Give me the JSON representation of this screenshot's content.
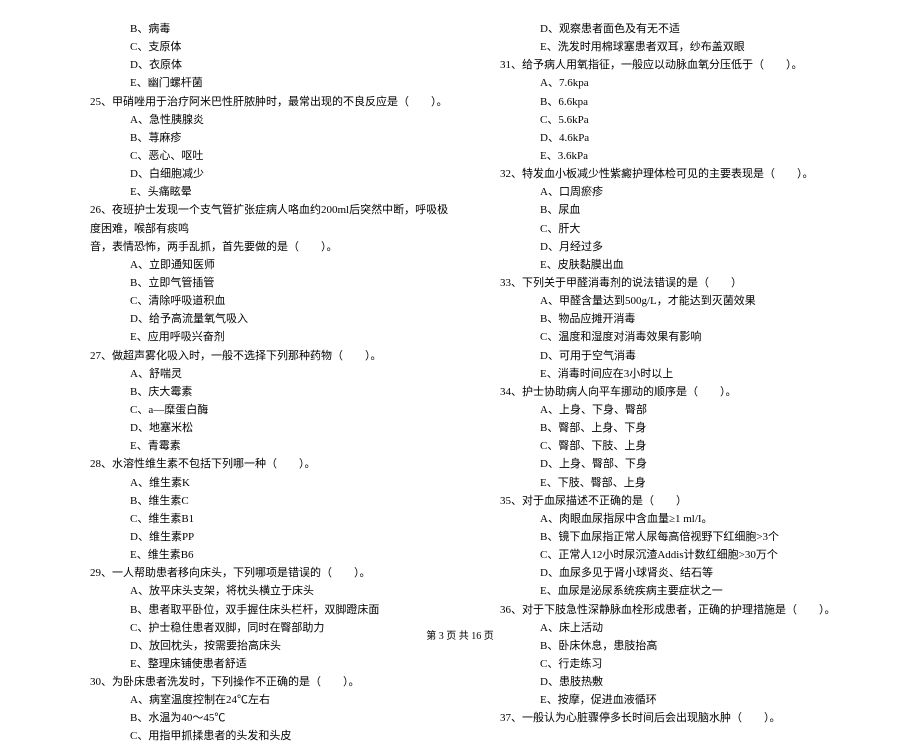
{
  "left": {
    "opts24": [
      "B、病毒",
      "C、支原体",
      "D、衣原体",
      "E、幽门螺杆菌"
    ],
    "q25": "25、甲硝唑用于治疗阿米巴性肝脓肿时，最常出现的不良反应是（　　）。",
    "opts25": [
      "A、急性胰腺炎",
      "B、荨麻疹",
      "C、恶心、呕吐",
      "D、白细胞减少",
      "E、头痛眩晕"
    ],
    "q26": "26、夜班护士发现一个支气管扩张症病人咯血约200ml后突然中断，呼吸极度困难，喉部有痰鸣",
    "q26b": "音，表情恐怖，两手乱抓，首先要做的是（　　）。",
    "opts26": [
      "A、立即通知医师",
      "B、立即气管插管",
      "C、清除呼吸道积血",
      "D、给予高流量氧气吸入",
      "E、应用呼吸兴奋剂"
    ],
    "q27": "27、做超声雾化吸入时，一般不选择下列那种药物（　　）。",
    "opts27": [
      "A、舒喘灵",
      "B、庆大霉素",
      "C、a—糜蛋白酶",
      "D、地塞米松",
      "E、青霉素"
    ],
    "q28": "28、水溶性维生素不包括下列哪一种（　　）。",
    "opts28": [
      "A、维生素K",
      "B、维生素C",
      "C、维生素B1",
      "D、维生素PP",
      "E、维生素B6"
    ],
    "q29": "29、一人帮助患者移向床头，下列哪项是错误的（　　）。",
    "opts29": [
      "A、放平床头支架，将枕头横立于床头",
      "B、患者取平卧位，双手握住床头栏杆，双脚蹬床面",
      "C、护士稳住患者双脚，同时在臀部助力",
      "D、放回枕头，按需要抬高床头",
      "E、整理床铺使患者舒适"
    ],
    "q30": "30、为卧床患者洗发时，下列操作不正确的是（　　）。",
    "opts30": [
      "A、病室温度控制在24℃左右",
      "B、水温为40～45℃",
      "C、用指甲抓揉患者的头发和头皮"
    ]
  },
  "right": {
    "opts30b": [
      "D、观察患者面色及有无不适",
      "E、洗发时用棉球塞患者双耳，纱布盖双眼"
    ],
    "q31": "31、给予病人用氧指征，一般应以动脉血氧分压低于（　　）。",
    "opts31": [
      "A、7.6kpa",
      "B、6.6kpa",
      "C、5.6kPa",
      "D、4.6kPa",
      "E、3.6kPa"
    ],
    "q32": "32、特发血小板减少性紫癜护理体检可见的主要表现是（　　）。",
    "opts32": [
      "A、口周瘀疹",
      "B、尿血",
      "C、肝大",
      "D、月经过多",
      "E、皮肤黏膜出血"
    ],
    "q33": "33、下列关于甲醛消毒剂的说法错误的是（　　）",
    "opts33": [
      "A、甲醛含量达到500g/L，才能达到灭菌效果",
      "B、物品应摊开消毒",
      "C、温度和湿度对消毒效果有影响",
      "D、可用于空气消毒",
      "E、消毒时间应在3小时以上"
    ],
    "q34": "34、护士协助病人向平车挪动的顺序是（　　）。",
    "opts34": [
      "A、上身、下身、臀部",
      "B、臀部、上身、下身",
      "C、臀部、下肢、上身",
      "D、上身、臀部、下身",
      "E、下肢、臀部、上身"
    ],
    "q35": "35、对于血尿描述不正确的是（　　）",
    "opts35": [
      "A、肉眼血尿指尿中含血量≥1 ml/I。",
      "B、镜下血尿指正常人尿每高倍视野下红细胞>3个",
      "C、正常人12小时尿沉渣Addis计数红细胞>30万个",
      "D、血尿多见于肾小球肾炎、结石等",
      "E、血尿是泌尿系统疾病主要症状之一"
    ],
    "q36": "36、对于下肢急性深静脉血栓形成患者，正确的护理措施是（　　）。",
    "opts36": [
      "A、床上活动",
      "B、卧床休息，患肢抬高",
      "C、行走练习",
      "D、患肢热敷",
      "E、按摩，促进血液循环"
    ],
    "q37": "37、一般认为心脏骤停多长时间后会出现脑水肿（　　）。"
  },
  "footer": "第 3 页 共 16 页"
}
